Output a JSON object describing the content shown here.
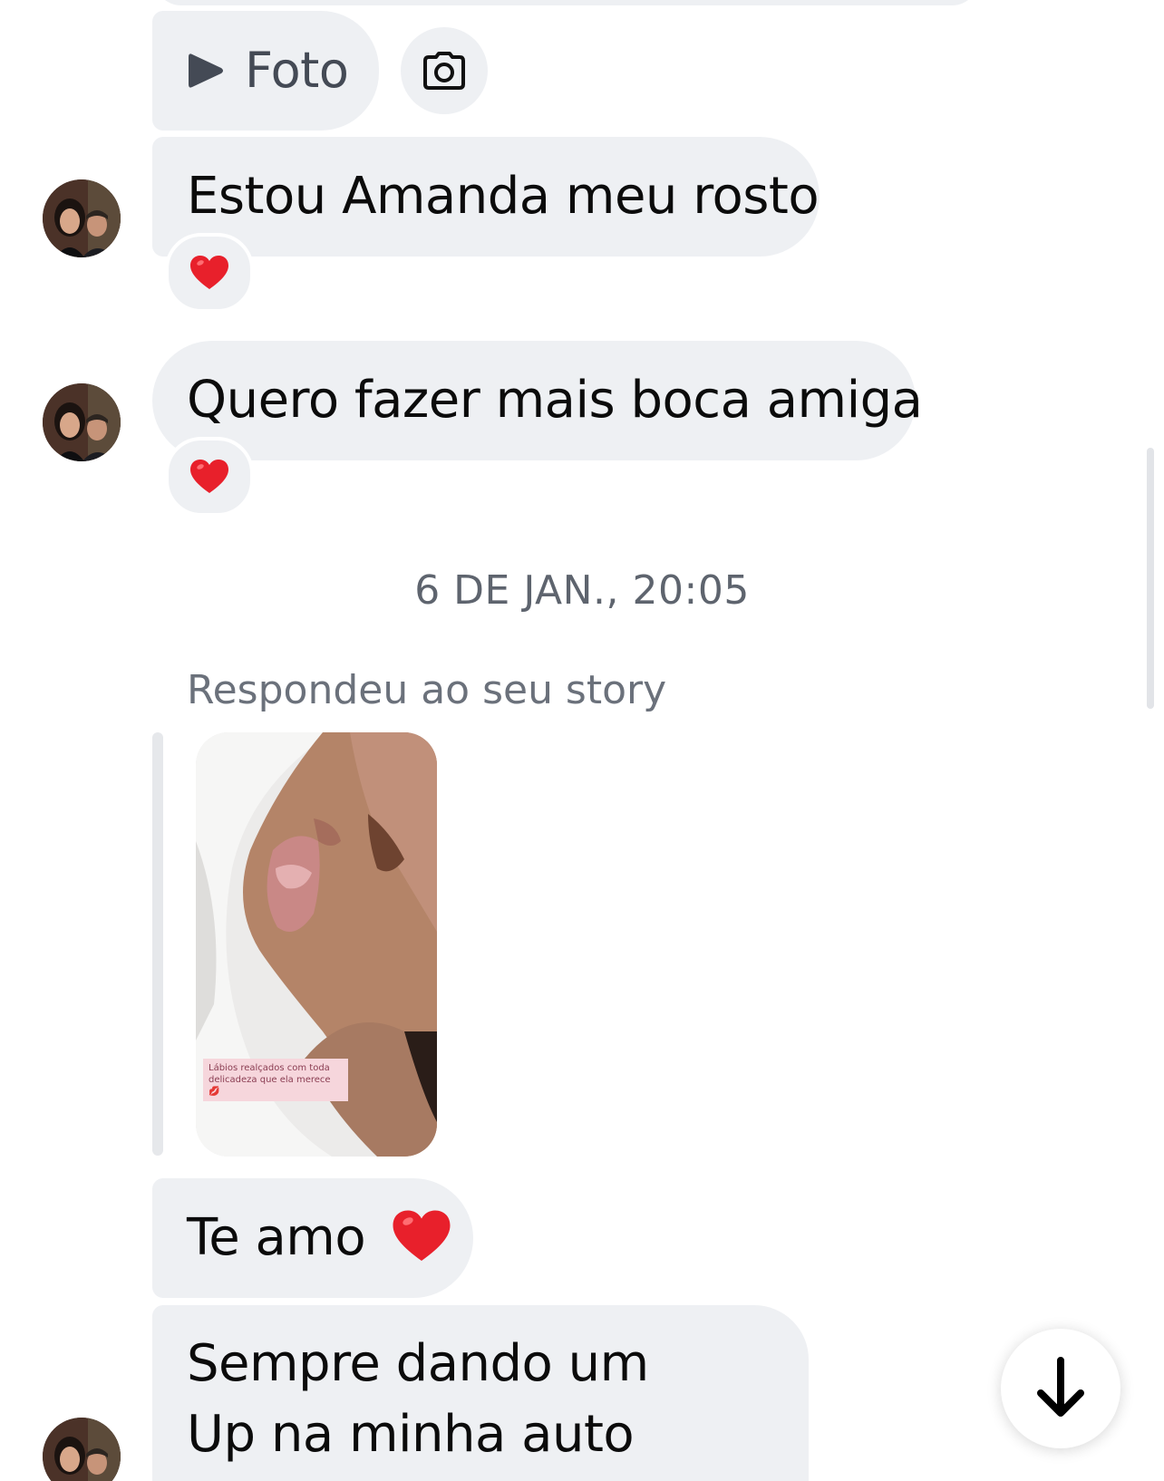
{
  "colors": {
    "bubble": "#eef0f3",
    "heart": "#e8202b",
    "muted_text": "#6b717b"
  },
  "media_message": {
    "label": "Foto",
    "icon": "play-icon"
  },
  "camera_button": {
    "icon": "camera-icon"
  },
  "messages": [
    {
      "text": "Estou Amanda meu rosto",
      "reaction": "heart-icon"
    },
    {
      "text": "Quero fazer mais boca amiga",
      "reaction": "heart-icon"
    }
  ],
  "timestamp": "6 DE JAN., 20:05",
  "story_reply": {
    "label": "Respondeu ao seu story",
    "caption": "Lábios realçados com toda delicadeza que ela merece 💋"
  },
  "later_messages": [
    {
      "text": "Te amo",
      "emoji": "heart-icon"
    },
    {
      "line1": "Sempre dando um",
      "line2": "Up na minha auto estima"
    }
  ],
  "scroll_button": {
    "icon": "arrow-down-icon"
  }
}
